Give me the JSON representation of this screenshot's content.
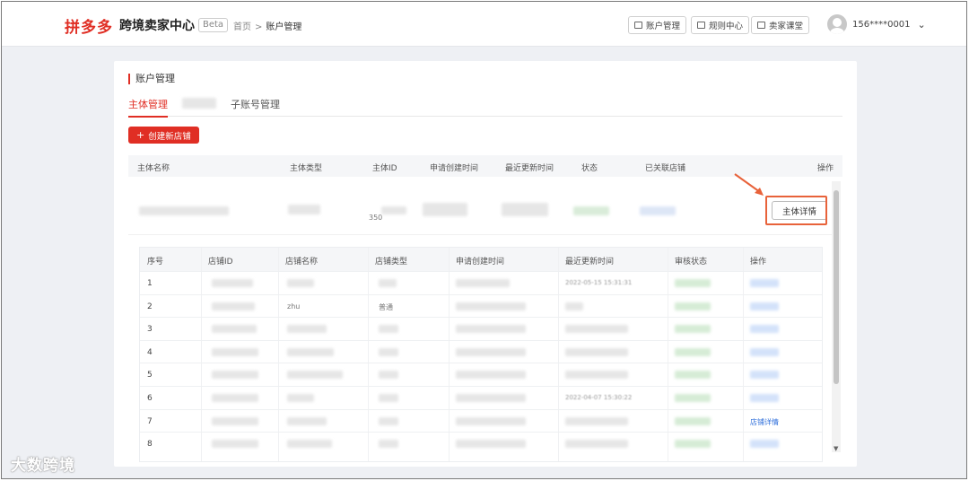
{
  "header": {
    "logo": "拼多多",
    "app_name": "跨境卖家中心",
    "beta": "Beta",
    "breadcrumb_home": "首页",
    "breadcrumb_sep": ">",
    "breadcrumb_current": "账户管理",
    "btn_account": "账户管理",
    "btn_rules": "规则中心",
    "btn_class": "卖家课堂",
    "user_phone": "156****0001",
    "chevron": "⌄"
  },
  "page": {
    "title": "账户管理",
    "tabs": [
      "主体管理",
      "账号管理",
      "子账号管理"
    ],
    "create_button": "创建新店铺",
    "create_plus": "+"
  },
  "main_table": {
    "headers": [
      "主体名称",
      "主体类型",
      "主体ID",
      "申请创建时间",
      "最近更新时间",
      "状态",
      "已关联店铺",
      "操作"
    ],
    "detail_button": "主体详情",
    "id_fragment": "350"
  },
  "store_table": {
    "headers": [
      "序号",
      "店铺ID",
      "店铺名称",
      "店铺类型",
      "申请创建时间",
      "最近更新时间",
      "审核状态",
      "操作"
    ],
    "rows": [
      {
        "no": "1",
        "name": "",
        "type": "",
        "updated": "2022-05-15 15:31:31",
        "action": ""
      },
      {
        "no": "2",
        "name": "zhu",
        "type": "普通",
        "updated": "",
        "action": ""
      },
      {
        "no": "3",
        "name": "",
        "type": "",
        "updated": "",
        "action": ""
      },
      {
        "no": "4",
        "name": "",
        "type": "",
        "updated": "",
        "action": ""
      },
      {
        "no": "5",
        "name": "",
        "type": "",
        "updated": "",
        "action": ""
      },
      {
        "no": "6",
        "name": "",
        "type": "",
        "updated": "2022-04-07 15:30:22",
        "action": ""
      },
      {
        "no": "7",
        "name": "",
        "type": "",
        "updated": "",
        "action": "店铺详情"
      },
      {
        "no": "8",
        "name": "",
        "type": "",
        "updated": "",
        "action": ""
      }
    ]
  },
  "watermark": "大数跨境",
  "colors": {
    "brand": "#e02e24",
    "link": "#2f6fdb",
    "highlight": "#e8623a"
  }
}
